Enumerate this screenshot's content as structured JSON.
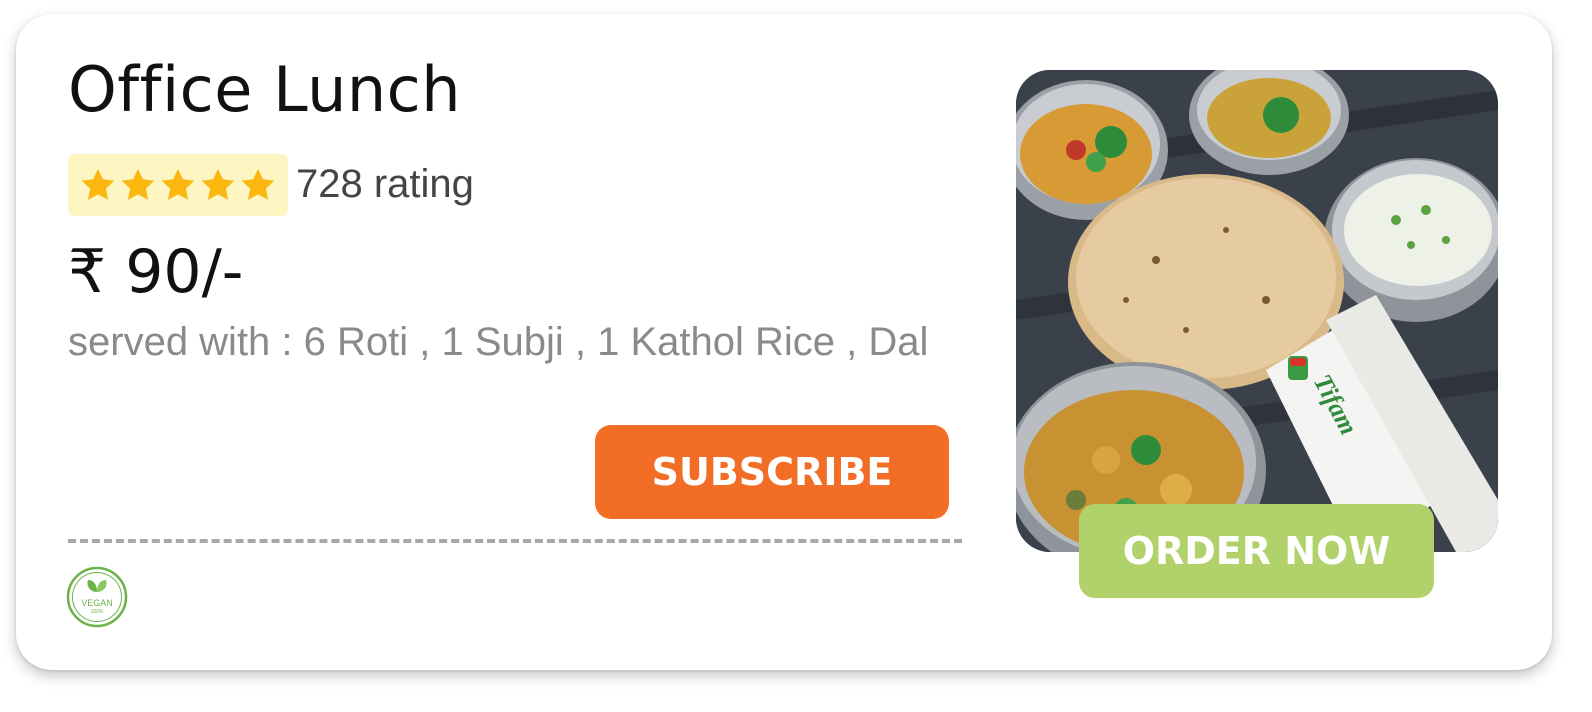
{
  "card": {
    "title": "Office Lunch",
    "rating": {
      "stars": 5,
      "max_stars": 5,
      "text": "728 rating"
    },
    "price": "₹ 90/-",
    "served_with": "served with : 6 Roti , 1 Subji , 1 Kathol Rice , Dal",
    "subscribe_label": "SUBSCRIBE",
    "order_label": "ORDER NOW",
    "vegan_badge": {
      "label": "VEGAN",
      "sublabel": "100%",
      "icon": "leaf-icon"
    },
    "image": {
      "description_icon": "food-photo",
      "brand_text": "Tifam"
    }
  },
  "colors": {
    "subscribe_bg": "#f26d26",
    "order_bg": "#b1d16b",
    "star": "#fbb710",
    "star_box_bg": "#fdf6c3",
    "vegan_green": "#6cb24a"
  }
}
